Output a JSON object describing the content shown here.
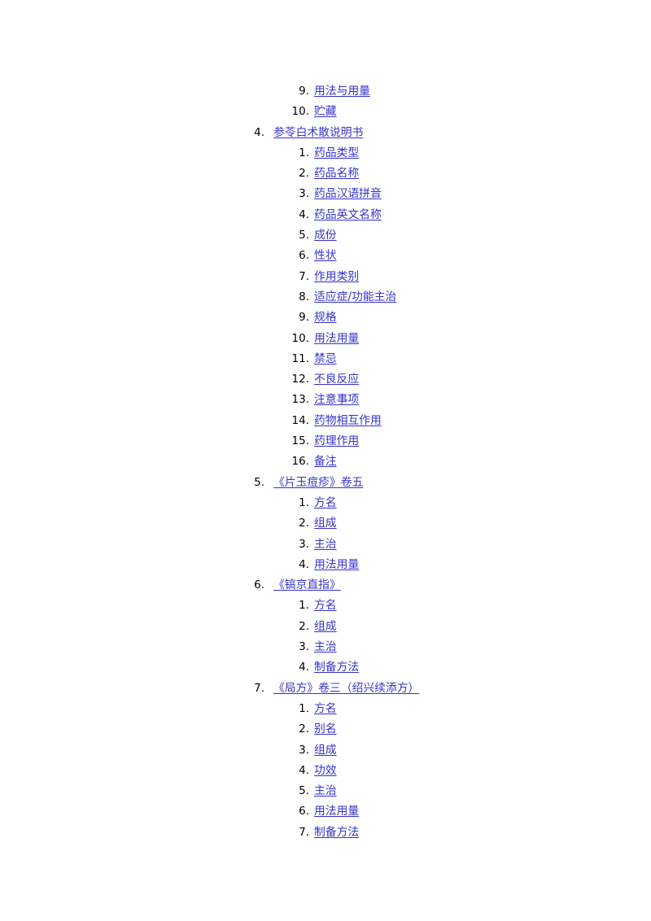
{
  "document": {
    "type": "table-of-contents",
    "link_color": "#3333CC",
    "number_color": "#000000",
    "background_color": "#FFFFFF"
  },
  "toc": {
    "entries": [
      {
        "level": 2,
        "number": "9.",
        "label": "用法与用量"
      },
      {
        "level": 2,
        "number": "10.",
        "label": "贮藏"
      },
      {
        "level": 1,
        "number": "4.",
        "label": "参苓白术散说明书"
      },
      {
        "level": 2,
        "number": "1.",
        "label": "药品类型"
      },
      {
        "level": 2,
        "number": "2.",
        "label": "药品名称"
      },
      {
        "level": 2,
        "number": "3.",
        "label": "药品汉语拼音"
      },
      {
        "level": 2,
        "number": "4.",
        "label": "药品英文名称"
      },
      {
        "level": 2,
        "number": "5.",
        "label": "成份"
      },
      {
        "level": 2,
        "number": "6.",
        "label": "性状"
      },
      {
        "level": 2,
        "number": "7.",
        "label": "作用类别"
      },
      {
        "level": 2,
        "number": "8.",
        "label": "适应症/功能主治"
      },
      {
        "level": 2,
        "number": "9.",
        "label": "规格"
      },
      {
        "level": 2,
        "number": "10.",
        "label": "用法用量"
      },
      {
        "level": 2,
        "number": "11.",
        "label": "禁忌"
      },
      {
        "level": 2,
        "number": "12.",
        "label": "不良反应"
      },
      {
        "level": 2,
        "number": "13.",
        "label": "注意事项"
      },
      {
        "level": 2,
        "number": "14.",
        "label": "药物相互作用"
      },
      {
        "level": 2,
        "number": "15.",
        "label": "药理作用"
      },
      {
        "level": 2,
        "number": "16.",
        "label": "备注"
      },
      {
        "level": 1,
        "number": "5.",
        "label": "《片玉痘疹》卷五"
      },
      {
        "level": 2,
        "number": "1.",
        "label": "方名"
      },
      {
        "level": 2,
        "number": "2.",
        "label": "组成"
      },
      {
        "level": 2,
        "number": "3.",
        "label": "主治"
      },
      {
        "level": 2,
        "number": "4.",
        "label": "用法用量"
      },
      {
        "level": 1,
        "number": "6.",
        "label": "《镐京直指》"
      },
      {
        "level": 2,
        "number": "1.",
        "label": "方名"
      },
      {
        "level": 2,
        "number": "2.",
        "label": "组成"
      },
      {
        "level": 2,
        "number": "3.",
        "label": "主治"
      },
      {
        "level": 2,
        "number": "4.",
        "label": "制备方法"
      },
      {
        "level": 1,
        "number": "7.",
        "label": "《局方》卷三（绍兴续添方）"
      },
      {
        "level": 2,
        "number": "1.",
        "label": "方名"
      },
      {
        "level": 2,
        "number": "2.",
        "label": "别名"
      },
      {
        "level": 2,
        "number": "3.",
        "label": "组成"
      },
      {
        "level": 2,
        "number": "4.",
        "label": "功效"
      },
      {
        "level": 2,
        "number": "5.",
        "label": "主治"
      },
      {
        "level": 2,
        "number": "6.",
        "label": "用法用量"
      },
      {
        "level": 2,
        "number": "7.",
        "label": "制备方法"
      }
    ]
  }
}
